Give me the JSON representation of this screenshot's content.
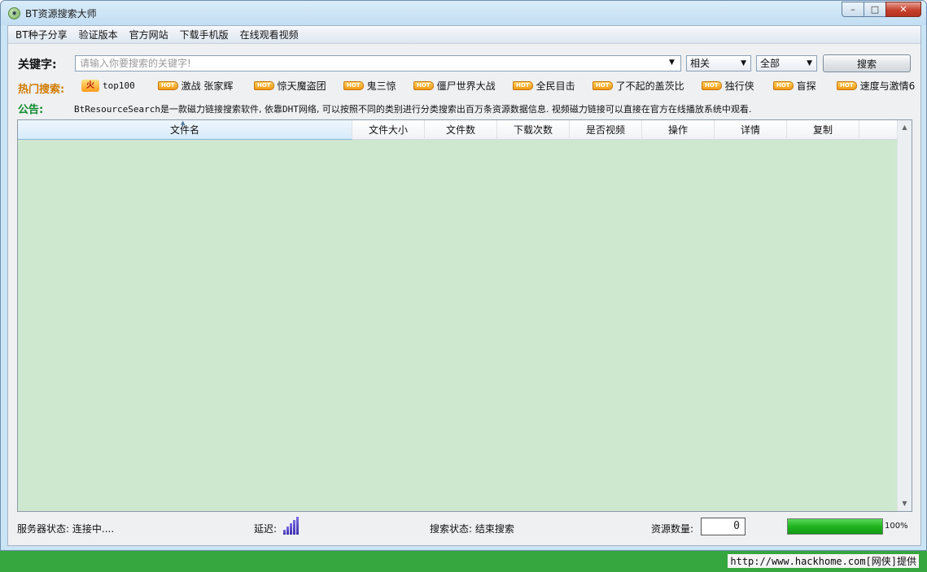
{
  "window": {
    "title": "BT资源搜索大师",
    "controls": {
      "minimize": "–",
      "maximize": "□",
      "close": "✕"
    }
  },
  "menu": {
    "items": [
      "BT种子分享",
      "验证版本",
      "官方网站",
      "下载手机版",
      "在线观看视频"
    ]
  },
  "search": {
    "label": "关键字:",
    "placeholder": "请输入你要搜索的关键字!",
    "value": "",
    "sort_select": "相关",
    "category_select": "全部",
    "button": "搜索"
  },
  "hot": {
    "label": "热门搜索:",
    "fire_badge": "火",
    "hot_badge": "HOT",
    "items": [
      "top100",
      "激战 张家辉",
      "惊天魔盗团",
      "鬼三惊",
      "僵尸世界大战",
      "全民目击",
      "了不起的盖茨比",
      "独行侠",
      "盲探",
      "速度与激情6"
    ]
  },
  "notice": {
    "label": "公告:",
    "prefix": "BtResourceSearch",
    "text": "是一款磁力链接搜索软件, 依靠",
    "dht": "DHT",
    "text2": "网络, 可以按照不同的类别进行分类搜索出百万条资源数据信息. 视频磁力链接可以直接在官方在线播放系统中观看."
  },
  "table": {
    "columns": [
      "文件名",
      "文件大小",
      "文件数",
      "下载次数",
      "是否视频",
      "操作",
      "详情",
      "复制"
    ],
    "rows": []
  },
  "status": {
    "server_label": "服务器状态:",
    "server_value": "连接中....",
    "latency_label": "延迟:",
    "search_label": "搜索状态:",
    "search_value": "结束搜索",
    "count_label": "资源数量:",
    "count_value": "0",
    "progress_percent": 100,
    "progress_text": "100%"
  },
  "footer": {
    "watermark": "http://www.hackhome.com[网侠]提供"
  },
  "colors": {
    "grid_background": "#cde8cf",
    "hot_label": "#d07a00",
    "notice_label": "#0b8a2a",
    "bottom_bar": "#36a63f"
  },
  "icons": {
    "app": "app-logo-icon",
    "latency": "signal-bars-icon",
    "dropdown": "chevron-down-icon"
  }
}
